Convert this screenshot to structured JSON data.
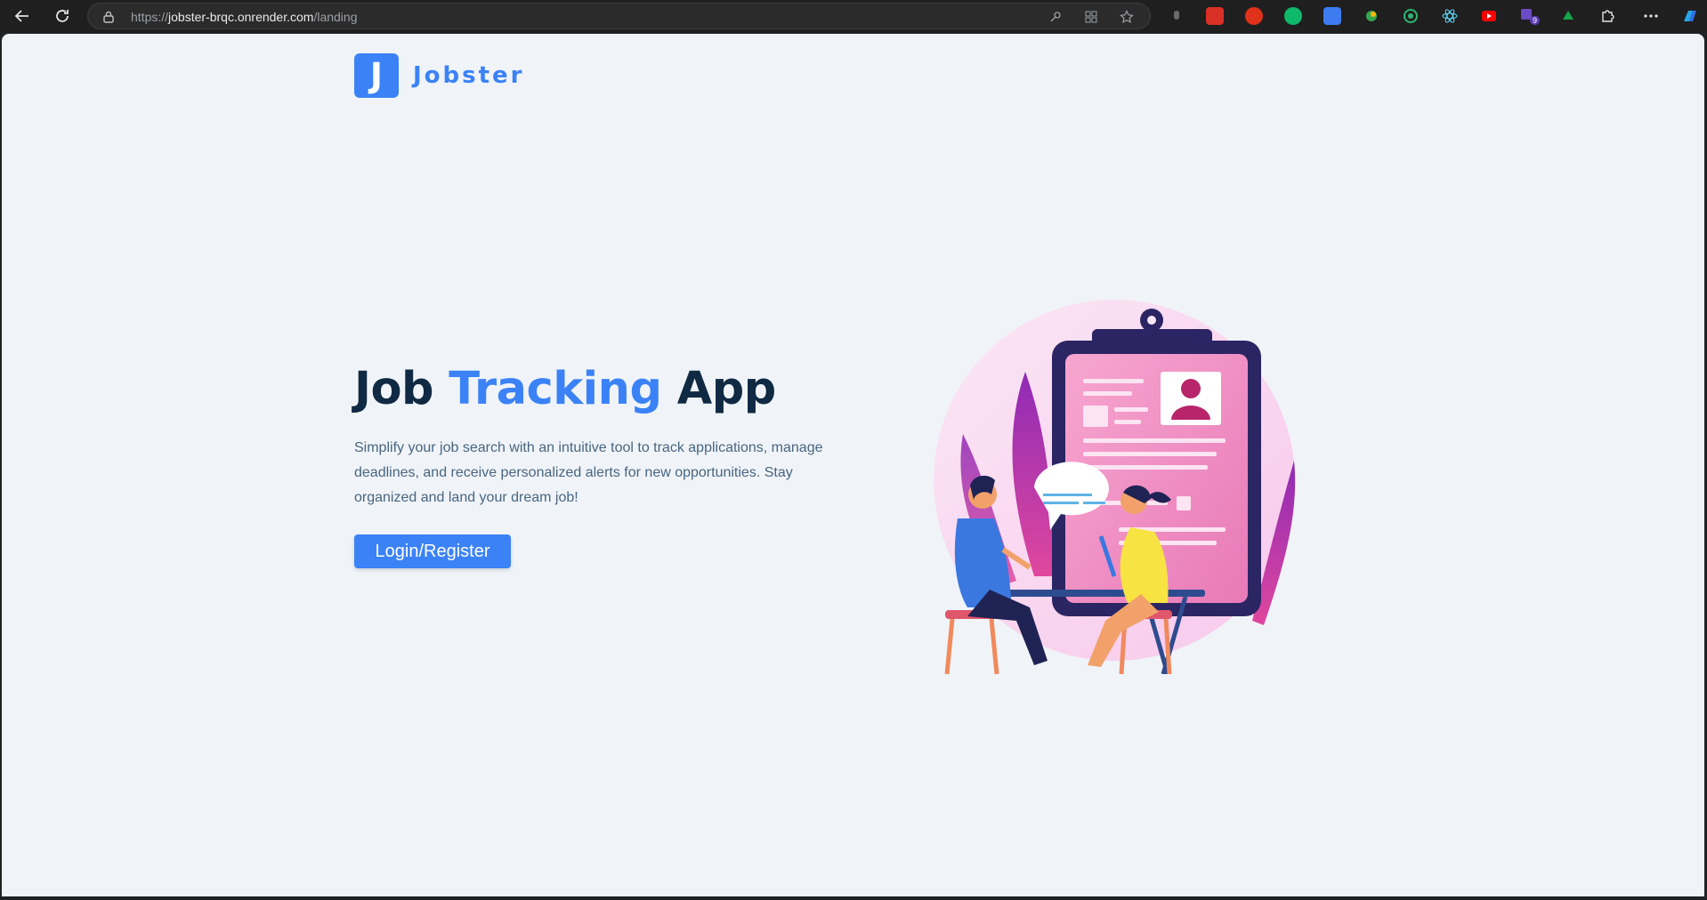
{
  "browser": {
    "url_scheme": "https://",
    "url_host": "jobster-brqc.onrender.com",
    "url_path": "/landing",
    "extension_badge": "9"
  },
  "logo": {
    "letter": "J",
    "name": "Jobster"
  },
  "hero": {
    "title_part1": "Job ",
    "title_accent": "Tracking",
    "title_part2": " App",
    "description": "Simplify your job search with an intuitive tool to track applications, manage deadlines, and receive personalized alerts for new opportunities. Stay organized and land your dream job!",
    "cta_label": "Login/Register"
  },
  "colors": {
    "primary": "#3b82f6",
    "background": "#f0f4f8",
    "heading": "#102a43",
    "text": "#486581"
  }
}
